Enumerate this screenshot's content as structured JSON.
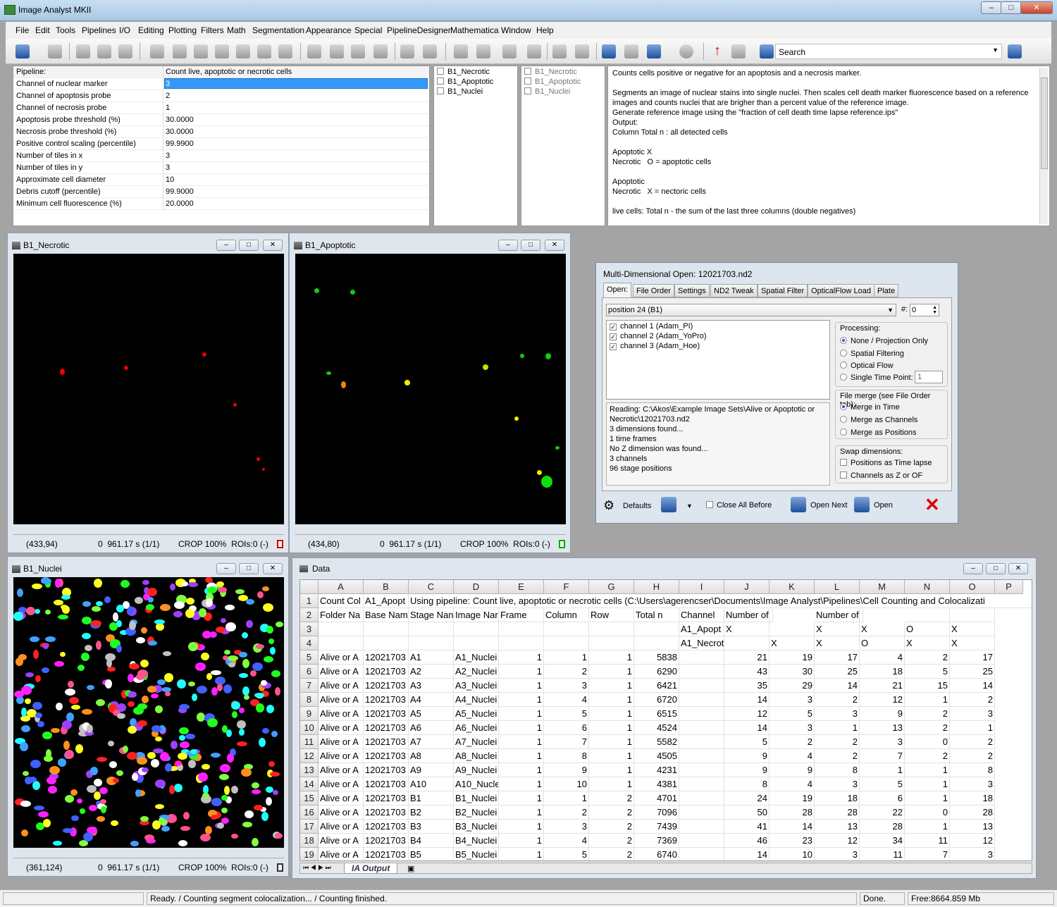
{
  "app": {
    "title": "Image Analyst MKII"
  },
  "menu": [
    "File",
    "Edit",
    "Tools",
    "Pipelines",
    "I/O",
    "Editing",
    "Plotting",
    "Filters",
    "Math",
    "Segmentation",
    "Appearance",
    "Special",
    "PipelineDesigner",
    "Mathematica",
    "Window",
    "Help"
  ],
  "toolbar": {
    "search_value": "Search"
  },
  "pipeline": {
    "label": "Pipeline:",
    "name": "Count live, apoptotic or necrotic cells",
    "params": [
      {
        "label": "Channel of nuclear marker",
        "value": "3"
      },
      {
        "label": "Channel of apoptosis probe",
        "value": "2"
      },
      {
        "label": "Channel of necrosis probe",
        "value": "1"
      },
      {
        "label": "Apoptosis probe threshold (%)",
        "value": "30.0000"
      },
      {
        "label": "Necrosis probe threshold (%)",
        "value": "30.0000"
      },
      {
        "label": "Positive control scaling (percentile)",
        "value": "99.9900"
      },
      {
        "label": "Number of tiles in x",
        "value": "3"
      },
      {
        "label": "Number of tiles in y",
        "value": "3"
      },
      {
        "label": "Approximate cell diameter",
        "value": "10"
      },
      {
        "label": "Debris cutoff (percentile)",
        "value": "99.9000"
      },
      {
        "label": "Minimum cell fluorescence (%)",
        "value": "20.0000"
      }
    ]
  },
  "images_list_a": [
    "B1_Necrotic",
    "B1_Apoptotic",
    "B1_Nuclei"
  ],
  "images_list_b": [
    "B1_Necrotic",
    "B1_Apoptotic",
    "B1_Nuclei"
  ],
  "description": [
    "Counts cells positive or negative for an apoptosis and a necrosis marker.",
    "",
    "Segments an image of nuclear stains into single nuclei. Then scales cell death marker fluorescence based on a reference",
    "images and counts nuclei that are brigher than a percent value of the reference image.",
    "Generate reference image using the \"fraction of cell death time lapse reference.ips\"",
    "Output:",
    "Column Total n : all detected cells",
    "",
    "Apoptotic X",
    "Necrotic   O = apoptotic cells",
    "",
    "Apoptotic",
    "Necrotic   X = nectoric cells",
    "",
    "live cells: Total n - the sum of the last three columns (double negatives)"
  ],
  "windows": {
    "necrotic": {
      "title": "B1_Necrotic",
      "coords": "(433,94)",
      "time": "0  961.17 s (1/1)",
      "info": "CROP 100%  ROIs:0 (-)"
    },
    "apoptotic": {
      "title": "B1_Apoptotic",
      "coords": "(434,80)",
      "time": "0  961.17 s (1/1)",
      "info": "CROP 100%  ROIs:0 (-)"
    },
    "nuclei": {
      "title": "B1_Nuclei",
      "coords": "(361,124)",
      "time": "0  961.17 s (1/1)",
      "info": "CROP 100%  ROIs:0 (-)"
    }
  },
  "dialog": {
    "title": "Multi-Dimensional Open: 12021703.nd2",
    "tabs": [
      "Open:",
      "File Order",
      "Settings",
      "ND2 Tweak",
      "Spatial Filter",
      "OpticalFlow Load",
      "Plate"
    ],
    "position": "position 24 (B1)",
    "hash_label": "#:",
    "hash_value": "0",
    "channels": [
      "channel 1 (Adam_PI)",
      "channel 2 (Adam_YoPro)",
      "channel 3 (Adam_Hoe)"
    ],
    "log": [
      "Reading: C:\\Akos\\Example Image Sets\\Alive or Apoptotic or",
      "Necrotic\\12021703.nd2",
      "3 dimensions found...",
      "1 time frames",
      "No Z dimension was found...",
      "3 channels",
      "96 stage positions"
    ],
    "processing_title": "Processing:",
    "processing": [
      "None / Projection Only",
      "Spatial Filtering",
      "Optical Flow",
      "Single Time Point:"
    ],
    "single_tp_value": "1",
    "merge_title": "File merge (see File Order tab):",
    "merge": [
      "Merge in Time",
      "Merge as Channels",
      "Merge as Positions"
    ],
    "swap_title": "Swap dimensions:",
    "swap": [
      "Positions as Time lapse",
      "Channels as Z or OF"
    ],
    "buttons": {
      "defaults": "Defaults",
      "close_all": "Close All Before",
      "open_next": "Open Next",
      "open": "Open"
    }
  },
  "data": {
    "title": "Data",
    "sheet_tab": "IA Output",
    "columns": [
      "A",
      "B",
      "C",
      "D",
      "E",
      "F",
      "G",
      "H",
      "I",
      "J",
      "K",
      "L",
      "M",
      "N",
      "O",
      "P"
    ],
    "rows": [
      [
        "1",
        "Count Col",
        "A1_Apopt",
        "Using pipeline: Count live, apoptotic or necrotic cells (C:\\Users\\agerencser\\Documents\\Image Analyst\\Pipelines\\Cell Counting and Colocalizati",
        "",
        "",
        "",
        "",
        "",
        "",
        "",
        "",
        "",
        "",
        "",
        ""
      ],
      [
        "2",
        "Folder Na",
        "Base Nam",
        "Stage Nan",
        "Image Nar",
        "Frame",
        "Column",
        "Row",
        "Total n",
        "Channel",
        "Number of segments positive a",
        "",
        "Number of segments positive/negative",
        "",
        "",
        ""
      ],
      [
        "3",
        "",
        "",
        "",
        "",
        "",
        "",
        "",
        "",
        "A1_Apopt",
        "X",
        "",
        "X",
        "X",
        "O",
        "X"
      ],
      [
        "4",
        "",
        "",
        "",
        "",
        "",
        "",
        "",
        "",
        "A1_Necrotic",
        "",
        "X",
        "X",
        "O",
        "X",
        "X"
      ],
      [
        "5",
        "Alive or A",
        "12021703",
        "A1",
        "A1_Nuclei",
        "1",
        "1",
        "1",
        "5838",
        "",
        "21",
        "19",
        "17",
        "4",
        "2",
        "17"
      ],
      [
        "6",
        "Alive or A",
        "12021703",
        "A2",
        "A2_Nuclei",
        "1",
        "2",
        "1",
        "6290",
        "",
        "43",
        "30",
        "25",
        "18",
        "5",
        "25"
      ],
      [
        "7",
        "Alive or A",
        "12021703",
        "A3",
        "A3_Nuclei",
        "1",
        "3",
        "1",
        "6421",
        "",
        "35",
        "29",
        "14",
        "21",
        "15",
        "14"
      ],
      [
        "8",
        "Alive or A",
        "12021703",
        "A4",
        "A4_Nuclei",
        "1",
        "4",
        "1",
        "6720",
        "",
        "14",
        "3",
        "2",
        "12",
        "1",
        "2"
      ],
      [
        "9",
        "Alive or A",
        "12021703",
        "A5",
        "A5_Nuclei",
        "1",
        "5",
        "1",
        "6515",
        "",
        "12",
        "5",
        "3",
        "9",
        "2",
        "3"
      ],
      [
        "10",
        "Alive or A",
        "12021703",
        "A6",
        "A6_Nuclei",
        "1",
        "6",
        "1",
        "4524",
        "",
        "14",
        "3",
        "1",
        "13",
        "2",
        "1"
      ],
      [
        "11",
        "Alive or A",
        "12021703",
        "A7",
        "A7_Nuclei",
        "1",
        "7",
        "1",
        "5582",
        "",
        "5",
        "2",
        "2",
        "3",
        "0",
        "2"
      ],
      [
        "12",
        "Alive or A",
        "12021703",
        "A8",
        "A8_Nuclei",
        "1",
        "8",
        "1",
        "4505",
        "",
        "9",
        "4",
        "2",
        "7",
        "2",
        "2"
      ],
      [
        "13",
        "Alive or A",
        "12021703",
        "A9",
        "A9_Nuclei",
        "1",
        "9",
        "1",
        "4231",
        "",
        "9",
        "9",
        "8",
        "1",
        "1",
        "8"
      ],
      [
        "14",
        "Alive or A",
        "12021703",
        "A10",
        "A10_Nucle",
        "1",
        "10",
        "1",
        "4381",
        "",
        "8",
        "4",
        "3",
        "5",
        "1",
        "3"
      ],
      [
        "15",
        "Alive or A",
        "12021703",
        "B1",
        "B1_Nuclei",
        "1",
        "1",
        "2",
        "4701",
        "",
        "24",
        "19",
        "18",
        "6",
        "1",
        "18"
      ],
      [
        "16",
        "Alive or A",
        "12021703",
        "B2",
        "B2_Nuclei",
        "1",
        "2",
        "2",
        "7096",
        "",
        "50",
        "28",
        "28",
        "22",
        "0",
        "28"
      ],
      [
        "17",
        "Alive or A",
        "12021703",
        "B3",
        "B3_Nuclei",
        "1",
        "3",
        "2",
        "7439",
        "",
        "41",
        "14",
        "13",
        "28",
        "1",
        "13"
      ],
      [
        "18",
        "Alive or A",
        "12021703",
        "B4",
        "B4_Nuclei",
        "1",
        "4",
        "2",
        "7369",
        "",
        "46",
        "23",
        "12",
        "34",
        "11",
        "12"
      ],
      [
        "19",
        "Alive or A",
        "12021703",
        "B5",
        "B5_Nuclei",
        "1",
        "5",
        "2",
        "6740",
        "",
        "14",
        "10",
        "3",
        "11",
        "7",
        "3"
      ]
    ]
  },
  "status": {
    "message": "Ready. / Counting segment colocalization... / Counting finished.",
    "state": "Done.",
    "memory": "Free:8664.859 Mb"
  }
}
